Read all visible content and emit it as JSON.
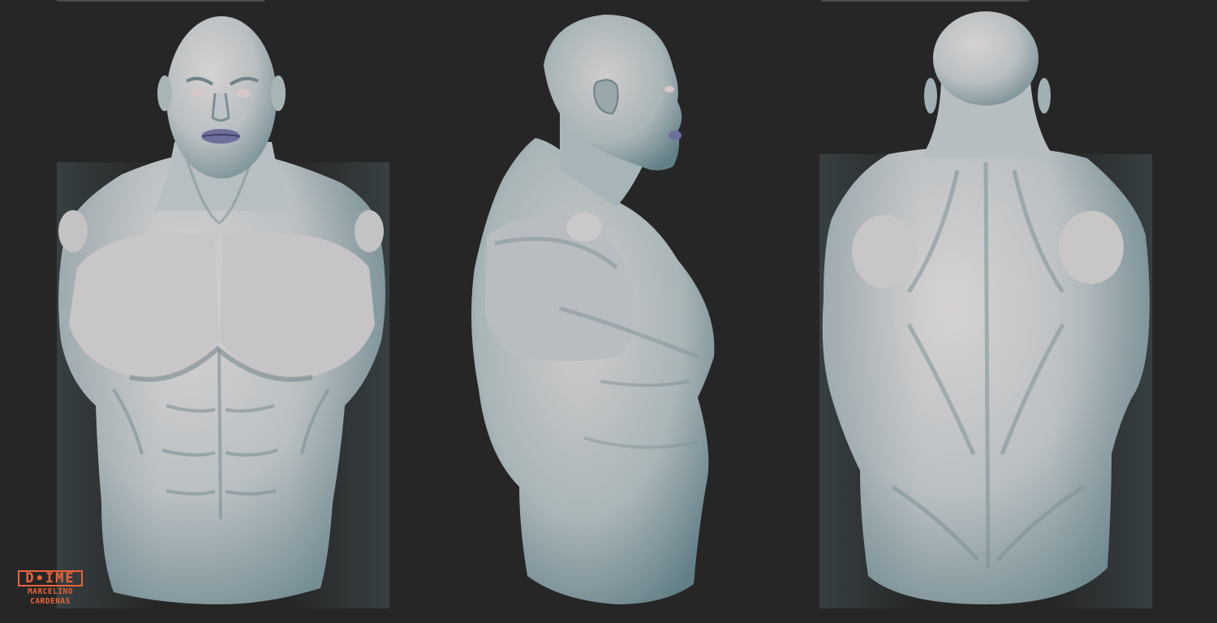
{
  "colors": {
    "background": "#262626",
    "skin": "#c4c6c8",
    "skin_shadow": "#7e949a",
    "lips": "#6f6f9c",
    "accent": "#e8643a"
  },
  "logo": {
    "mark": "D∙IME",
    "line1": "MARCELINO",
    "line2": "CARDENAS"
  },
  "views": [
    {
      "view": "front"
    },
    {
      "view": "side"
    },
    {
      "view": "back"
    }
  ]
}
